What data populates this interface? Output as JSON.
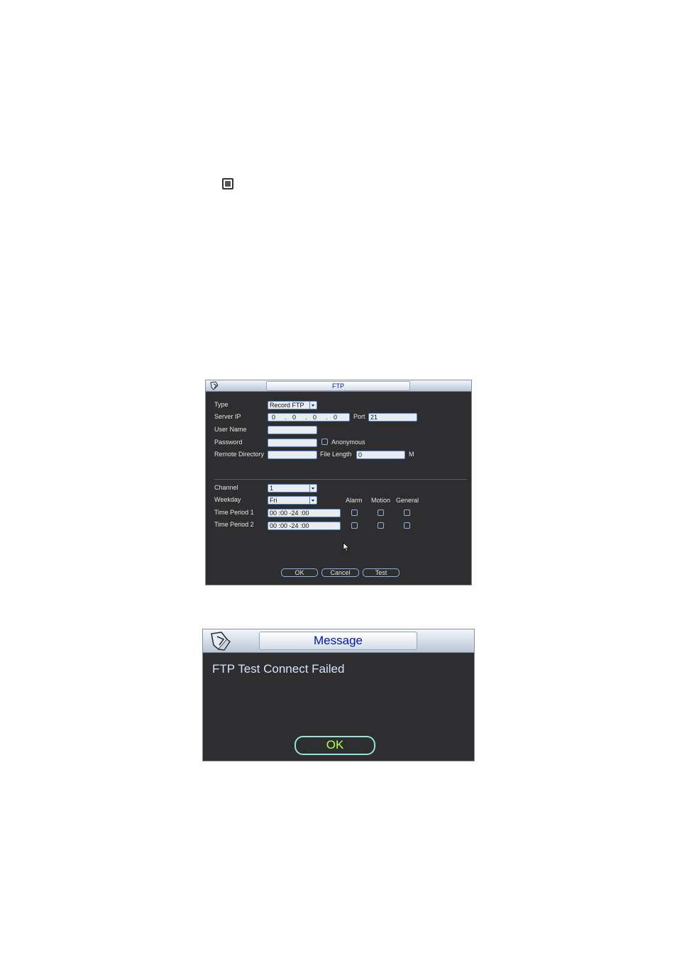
{
  "ftp": {
    "title": "FTP",
    "type_label": "Type",
    "type_value": "Record FTP",
    "server_ip_label": "Server IP",
    "ip": [
      "0",
      ".",
      "0",
      ".",
      "0",
      ".",
      "0"
    ],
    "port_label": "Port",
    "port_value": "21",
    "username_label": "User Name",
    "username_value": "",
    "password_label": "Password",
    "password_value": "",
    "anonymous_label": "Anonymous",
    "remote_dir_label": "Remote Directory",
    "remote_dir_value": "",
    "file_length_label": "File Length",
    "file_length_value": "0",
    "file_length_unit": "M",
    "channel_label": "Channel",
    "channel_value": "1",
    "weekday_label": "Weekday",
    "weekday_value": "Fri",
    "alarm_label": "Alarm",
    "motion_label": "Motion",
    "general_label": "General",
    "period1_label": "Time Period 1",
    "period1_value": "00 :00       -24 :00",
    "period2_label": "Time Period 2",
    "period2_value": "00 :00       -24 :00",
    "ok_label": "OK",
    "cancel_label": "Cancel",
    "test_label": "Test"
  },
  "message": {
    "title": "Message",
    "text": "FTP Test Connect Failed",
    "ok_label": "OK"
  },
  "colors": {
    "window_bg": "#2e2e30",
    "field_border": "#4f86c9",
    "title_text": "#0018a8",
    "ok_text": "#b6ff4a"
  }
}
